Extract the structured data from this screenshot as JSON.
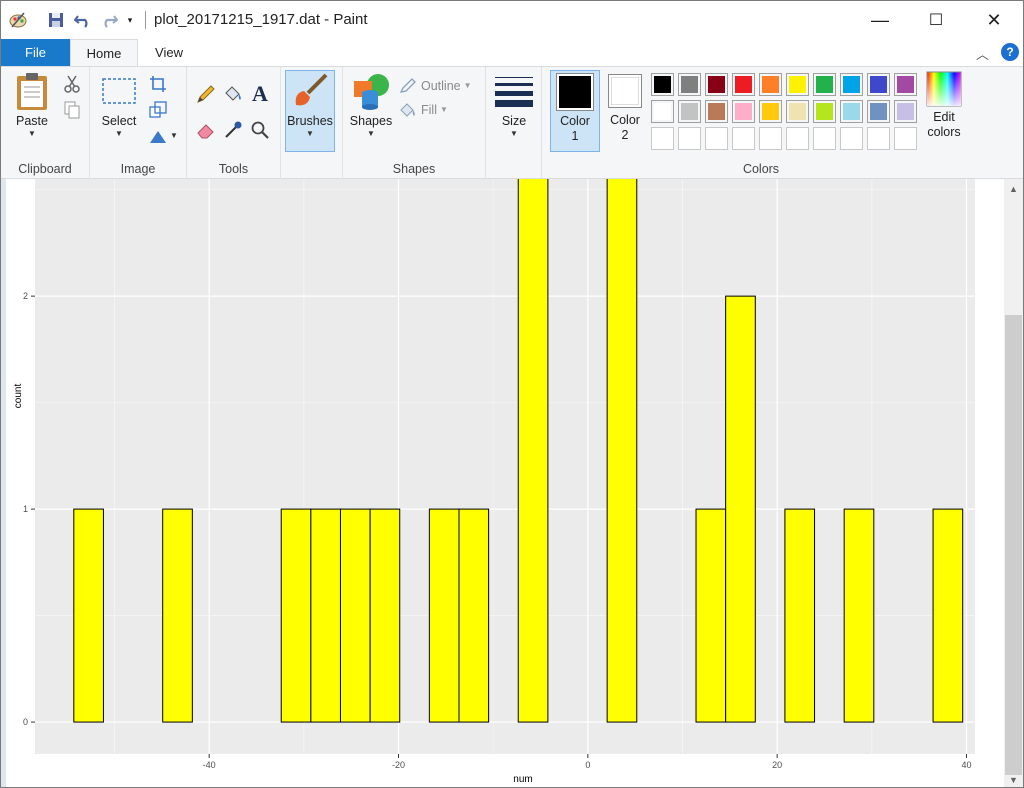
{
  "titlebar": {
    "title": "plot_20171215_1917.dat - Paint",
    "qat_icons": [
      "paint-app-icon",
      "save-icon",
      "undo-icon",
      "redo-icon",
      "qat-dropdown-icon"
    ],
    "minimize_glyph": "—",
    "maximize_glyph": "☐",
    "close_glyph": "✕"
  },
  "tabs": {
    "file": "File",
    "home": "Home",
    "view": "View"
  },
  "ribbon": {
    "clipboard": {
      "label": "Clipboard",
      "paste": "Paste"
    },
    "image": {
      "label": "Image",
      "select": "Select"
    },
    "tools": {
      "label": "Tools"
    },
    "brushes": {
      "label": "Brushes"
    },
    "shapes": {
      "label": "Shapes",
      "shapes_btn": "Shapes",
      "outline": "Outline",
      "fill": "Fill"
    },
    "size": {
      "label": "Size"
    },
    "colors": {
      "label": "Colors",
      "color1": "Color 1",
      "color1_line1": "Color",
      "color1_line2": "1",
      "color2_line1": "Color",
      "color2_line2": "2",
      "color1_value": "#000000",
      "color2_value": "#ffffff",
      "edit_line1": "Edit",
      "edit_line2": "colors",
      "palette_row1": [
        "#000000",
        "#7f7f7f",
        "#880015",
        "#ed1c24",
        "#ff7f27",
        "#fff200",
        "#22b14c",
        "#00a2e8",
        "#3f48cc",
        "#a349a4"
      ],
      "palette_row2": [
        "#ffffff",
        "#c3c3c3",
        "#b97a57",
        "#ffaec9",
        "#ffc90e",
        "#efe4b0",
        "#b5e61d",
        "#99d9ea",
        "#7092be",
        "#c8bfe7"
      ]
    }
  },
  "chart_data": {
    "type": "bar",
    "xlabel": "num",
    "ylabel": "count",
    "x_ticks": [
      -40,
      -20,
      0,
      20,
      40
    ],
    "y_ticks": [
      0,
      1,
      2
    ],
    "x_range": [
      -58.4,
      40.9
    ],
    "y_range": [
      -0.15,
      2.55
    ],
    "bar_fill": "#ffff00",
    "bar_edge": "#000000",
    "bins": {
      "start": -54.3,
      "width": 3.13,
      "counts": [
        1,
        0,
        0,
        1,
        0,
        0,
        0,
        1,
        1,
        1,
        1,
        0,
        1,
        1,
        0,
        3,
        0,
        0,
        3,
        0,
        0,
        1,
        2,
        0,
        1,
        0,
        1,
        0,
        0,
        1
      ]
    }
  }
}
